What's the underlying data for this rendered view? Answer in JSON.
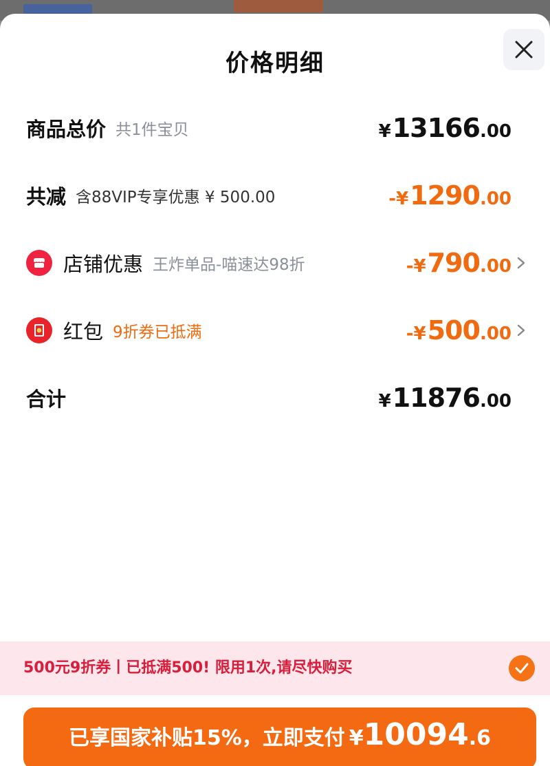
{
  "sheet": {
    "title": "价格明细",
    "close_icon": "close-icon"
  },
  "rows": {
    "subtotal": {
      "label": "商品总价",
      "note": "共1件宝贝",
      "currency": "¥",
      "int": "13166",
      "dec": ".00"
    },
    "discount": {
      "label": "共减",
      "note": "含88VIP专享优惠 ¥ 500.00",
      "currency": "-¥",
      "int": "1290",
      "dec": ".00"
    },
    "shop_promo": {
      "icon": "shop-icon",
      "label": "店铺优惠",
      "note": "王炸单品-喵速达98折",
      "currency": "-¥",
      "int": "790",
      "dec": ".00"
    },
    "red_packet": {
      "icon": "red-packet-icon",
      "label": "红包",
      "note": "9折券已抵满",
      "currency": "-¥",
      "int": "500",
      "dec": ".00"
    },
    "total": {
      "label": "合计",
      "currency": "¥",
      "int": "11876",
      "dec": ".00"
    }
  },
  "notice": {
    "text": "500元9折券丨已抵满500! 限用1次,请尽快购买",
    "checked": true
  },
  "pay_button": {
    "label": "已享国家补贴15%，立即支付",
    "currency": "¥",
    "int": "10094",
    "dec": ".6"
  },
  "colors": {
    "accent_orange": "#f06a0f",
    "button_orange": "#f46a12",
    "notice_bg": "#fde7ec",
    "notice_text": "#d81e3b",
    "shop_icon_red": "#ef2340"
  }
}
